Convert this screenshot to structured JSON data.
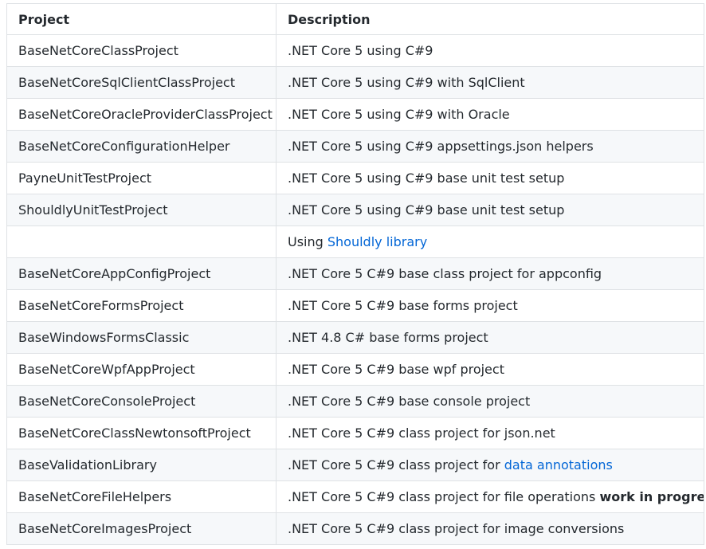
{
  "table": {
    "headers": {
      "project": "Project",
      "description": "Description"
    },
    "rows": [
      {
        "project": "BaseNetCoreClassProject",
        "description": ".NET Core 5 using C#9"
      },
      {
        "project": "BaseNetCoreSqlClientClassProject",
        "description": ".NET Core 5 using C#9 with SqlClient"
      },
      {
        "project": "BaseNetCoreOracleProviderClassProject",
        "description": ".NET Core 5 using C#9 with Oracle"
      },
      {
        "project": "BaseNetCoreConfigurationHelper",
        "description": ".NET Core 5 using C#9 appsettings.json helpers"
      },
      {
        "project": "PayneUnitTestProject",
        "description": ".NET Core 5 using C#9 base unit test setup"
      },
      {
        "project": "ShouldlyUnitTestProject",
        "description": ".NET Core 5 using C#9 base unit test setup"
      },
      {
        "project": "",
        "description_prefix": "Using ",
        "description_link": "Shouldly library"
      },
      {
        "project": "BaseNetCoreAppConfigProject",
        "description": ".NET Core 5 C#9 base class project for appconfig"
      },
      {
        "project": "BaseNetCoreFormsProject",
        "description": ".NET Core 5 C#9 base forms project"
      },
      {
        "project": "BaseWindowsFormsClassic",
        "description": ".NET 4.8 C# base forms project"
      },
      {
        "project": "BaseNetCoreWpfAppProject",
        "description": ".NET Core 5 C#9 base wpf project"
      },
      {
        "project": "BaseNetCoreConsoleProject",
        "description": ".NET Core 5 C#9 base console project"
      },
      {
        "project": "BaseNetCoreClassNewtonsoftProject",
        "description": ".NET Core 5 C#9 class project for json.net"
      },
      {
        "project": "BaseValidationLibrary",
        "description_prefix": ".NET Core 5 C#9 class project for ",
        "description_link": "data annotations"
      },
      {
        "project": "BaseNetCoreFileHelpers",
        "description_prefix": ".NET Core 5 C#9 class project for file operations ",
        "description_bold": "work in progress"
      },
      {
        "project": "BaseNetCoreImagesProject",
        "description": ".NET Core 5 C#9 class project for image conversions"
      }
    ]
  },
  "colors": {
    "link": "#0366d6",
    "text": "#24292e",
    "border": "#dfe2e5",
    "stripe": "#f6f8fa"
  }
}
